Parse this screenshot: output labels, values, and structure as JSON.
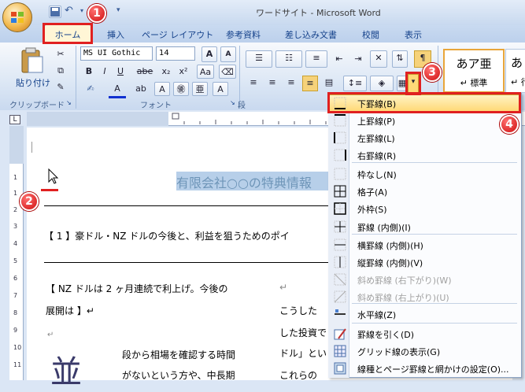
{
  "title": "ワードサイト - Microsoft Word",
  "tabs": [
    "ホーム",
    "挿入",
    "ページ レイアウト",
    "参考資料",
    "差し込み文書",
    "校閲",
    "表示"
  ],
  "ribbon": {
    "paste_label": "貼り付け",
    "clipboard_group": "クリップボード",
    "font_group": "フォント",
    "paragraph_group": "段",
    "font_name": "MS UI Gothic",
    "font_size": "14",
    "style_sample": "あア亜",
    "style_name": "↵ 標準",
    "style_sample2": "あ",
    "style_name2": "↵ 行"
  },
  "document": {
    "heading": "有限会社○○の特典情報",
    "line1": "【 1 】豪ドル・NZ ドルの今後と、利益を狙うためのポイ",
    "line2": "【 NZ ドルは 2 ヶ月連続で利上げ。今後の",
    "line2b": "↵",
    "line3": "展開は 】↵",
    "line4": "こうした",
    "line5": "した投資で",
    "line6": "ドル」とい",
    "line7": "これらの",
    "line8": "段から相場を確認する時間",
    "line9": "がないという方や、中長期",
    "drop_cap": "並"
  },
  "menu": [
    {
      "label": "下罫線(B)",
      "disabled": false,
      "icon": "bottom-border-icon"
    },
    {
      "label": "上罫線(P)",
      "disabled": false,
      "icon": "top-border-icon"
    },
    {
      "label": "左罫線(L)",
      "disabled": false,
      "icon": "left-border-icon"
    },
    {
      "label": "右罫線(R)",
      "disabled": false,
      "icon": "right-border-icon"
    },
    {
      "label": "枠なし(N)",
      "disabled": false,
      "icon": "no-border-icon"
    },
    {
      "label": "格子(A)",
      "disabled": false,
      "icon": "all-borders-icon"
    },
    {
      "label": "外枠(S)",
      "disabled": false,
      "icon": "outside-borders-icon"
    },
    {
      "label": "罫線 (内側)(I)",
      "disabled": false,
      "icon": "inside-borders-icon"
    },
    {
      "label": "横罫線 (内側)(H)",
      "disabled": false,
      "icon": "inside-horizontal-border-icon"
    },
    {
      "label": "縦罫線 (内側)(V)",
      "disabled": false,
      "icon": "inside-vertical-border-icon"
    },
    {
      "label": "斜め罫線 (右下がり)(W)",
      "disabled": true,
      "icon": "diagonal-down-border-icon"
    },
    {
      "label": "斜め罫線 (右上がり)(U)",
      "disabled": true,
      "icon": "diagonal-up-border-icon"
    },
    {
      "label": "水平線(Z)",
      "disabled": false,
      "icon": "horizontal-line-icon"
    },
    {
      "label": "罫線を引く(D)",
      "disabled": false,
      "icon": "draw-table-icon"
    },
    {
      "label": "グリッド線の表示(G)",
      "disabled": false,
      "icon": "view-gridlines-icon"
    },
    {
      "label": "線種とページ罫線と網かけの設定(O)...",
      "disabled": false,
      "icon": "borders-shading-icon"
    }
  ],
  "badges": [
    "1",
    "2",
    "3",
    "4"
  ],
  "colors": {
    "highlight_red": "#e02020",
    "menu_hover": "#ffd977"
  }
}
